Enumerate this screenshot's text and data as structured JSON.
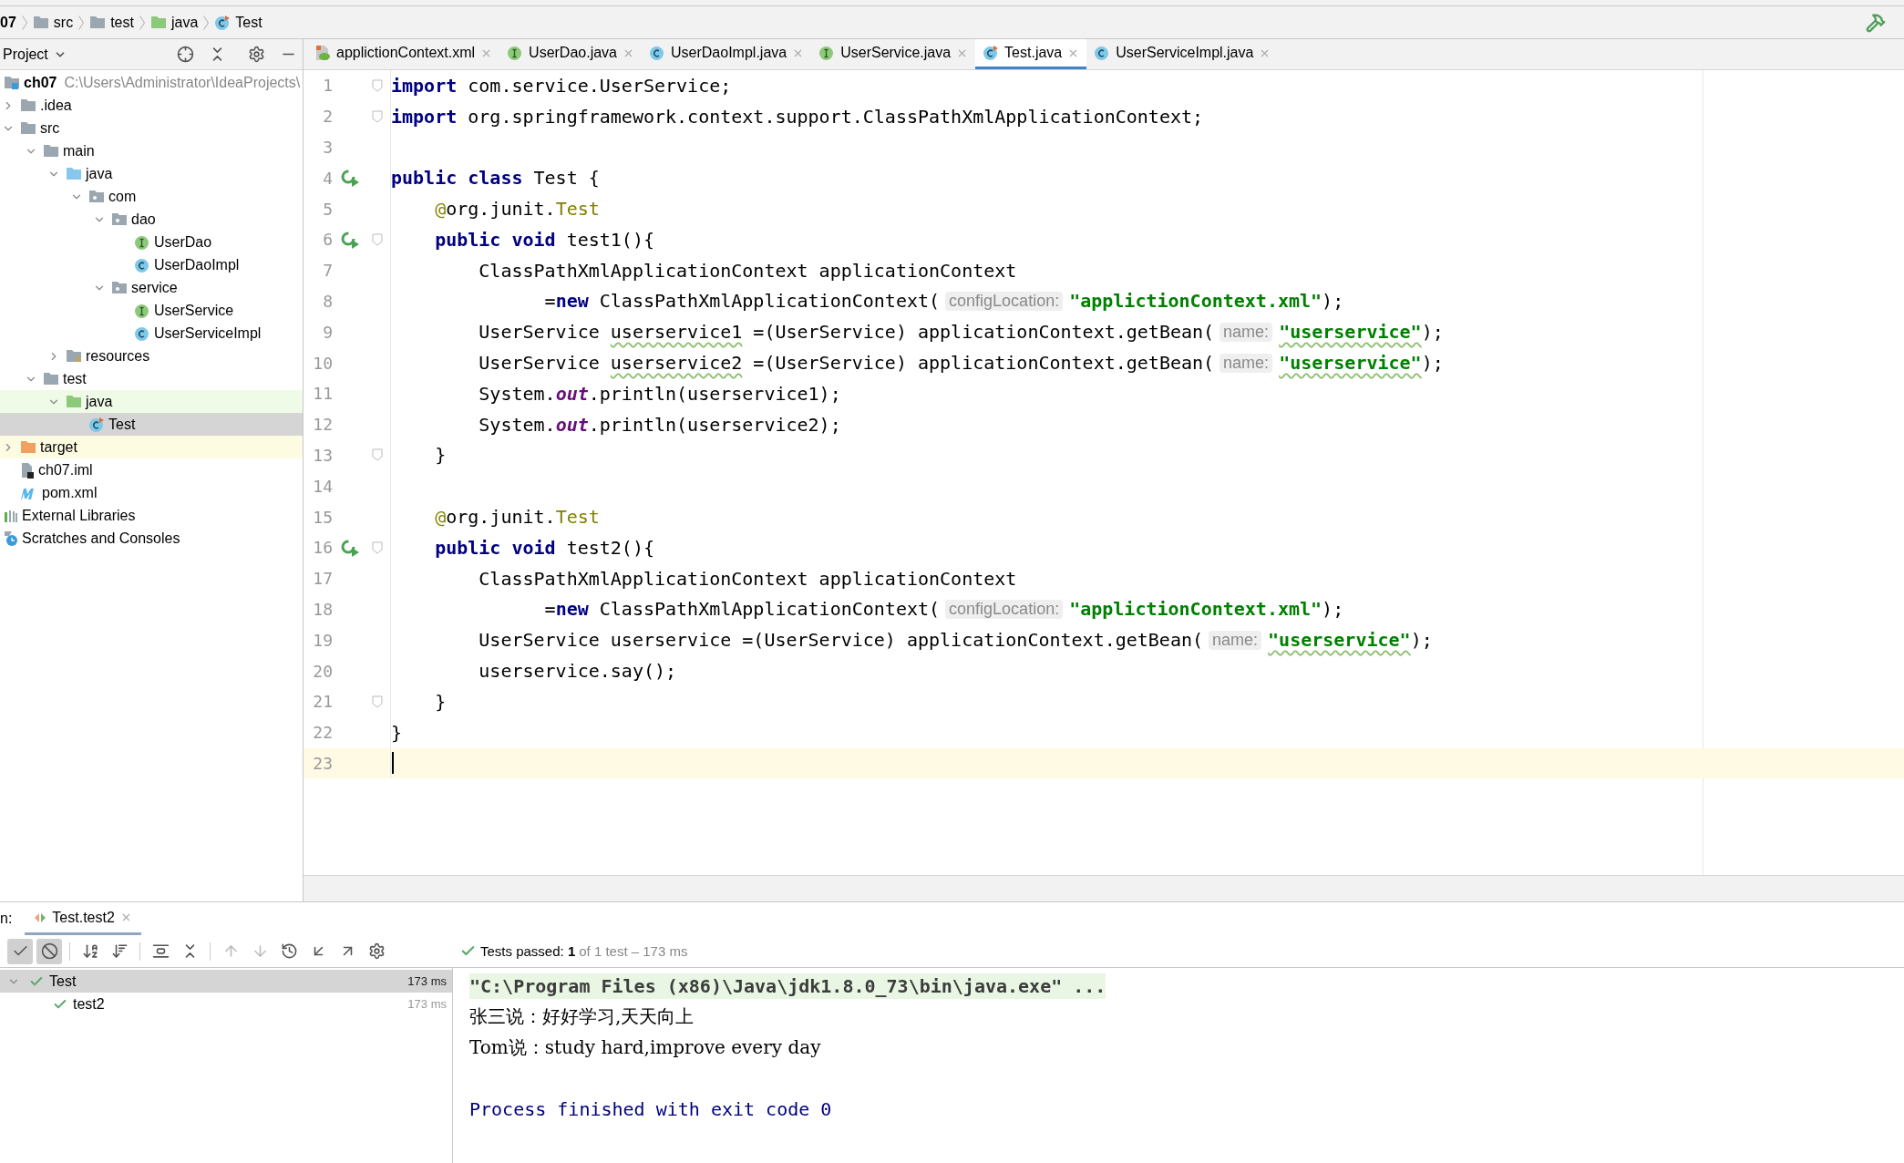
{
  "breadcrumb": [
    {
      "label": "07"
    },
    {
      "label": "src",
      "kind": "folder"
    },
    {
      "label": "test",
      "kind": "folder"
    },
    {
      "label": "java",
      "kind": "test_folder"
    },
    {
      "label": "Test",
      "kind": "test_class"
    }
  ],
  "project_panel": {
    "title": "Project",
    "tree": [
      {
        "label": "ch07",
        "kind": "module",
        "hint": "C:\\Users\\Administrator\\IdeaProjects\\",
        "selected": false,
        "children": [
          {
            "label": ".idea",
            "kind": "folder",
            "expanded": false,
            "selected": false
          },
          {
            "label": "src",
            "kind": "folder",
            "expanded": true,
            "selected": false,
            "children": [
              {
                "label": "main",
                "kind": "folder",
                "expanded": true,
                "selected": false,
                "children": [
                  {
                    "label": "java",
                    "kind": "source_folder",
                    "expanded": true,
                    "selected": false,
                    "children": [
                      {
                        "label": "com",
                        "kind": "package",
                        "expanded": true,
                        "selected": false,
                        "children": [
                          {
                            "label": "dao",
                            "kind": "package",
                            "expanded": true,
                            "selected": false,
                            "children": [
                              {
                                "label": "UserDao",
                                "kind": "interface",
                                "selected": false
                              },
                              {
                                "label": "UserDaoImpl",
                                "kind": "class",
                                "selected": false
                              }
                            ]
                          },
                          {
                            "label": "service",
                            "kind": "package",
                            "expanded": true,
                            "selected": false,
                            "children": [
                              {
                                "label": "UserService",
                                "kind": "interface",
                                "selected": false
                              },
                              {
                                "label": "UserServiceImpl",
                                "kind": "class",
                                "selected": false
                              }
                            ]
                          }
                        ]
                      }
                    ]
                  },
                  {
                    "label": "resources",
                    "kind": "resources",
                    "expanded": false,
                    "selected": false
                  }
                ]
              },
              {
                "label": "test",
                "kind": "folder",
                "expanded": true,
                "selected": false,
                "children": [
                  {
                    "label": "java",
                    "kind": "test_folder",
                    "expanded": true,
                    "selected": false,
                    "color": "#effbe7",
                    "children": [
                      {
                        "label": "Test",
                        "kind": "test_class",
                        "selected": true
                      }
                    ]
                  }
                ]
              }
            ]
          },
          {
            "label": "target",
            "kind": "excluded",
            "expanded": false,
            "selected": false,
            "color": "#fdfbe2"
          },
          {
            "label": "ch07.iml",
            "kind": "iml",
            "selected": false
          },
          {
            "label": "pom.xml",
            "kind": "maven",
            "selected": false
          }
        ]
      },
      {
        "label": "External Libraries",
        "kind": "libraries",
        "selected": false
      },
      {
        "label": "Scratches and Consoles",
        "kind": "scratches",
        "selected": false
      }
    ]
  },
  "tabs": [
    {
      "label": "applictionContext.xml",
      "kind": "xml",
      "selected": false
    },
    {
      "label": "UserDao.java",
      "kind": "interface",
      "selected": false
    },
    {
      "label": "UserDaoImpl.java",
      "kind": "class",
      "selected": false
    },
    {
      "label": "UserService.java",
      "kind": "interface",
      "selected": false
    },
    {
      "label": "Test.java",
      "kind": "test_class",
      "selected": true
    },
    {
      "label": "UserServiceImpl.java",
      "kind": "class",
      "selected": false
    }
  ],
  "code_lines": [
    {
      "number": "1",
      "run": false,
      "fold": true,
      "current": false,
      "segments": [
        {
          "kind": "keyword",
          "text": "import"
        },
        {
          "kind": "plain",
          "text": " com.service.UserService;"
        }
      ]
    },
    {
      "number": "2",
      "run": false,
      "fold": true,
      "current": false,
      "segments": [
        {
          "kind": "keyword",
          "text": "import"
        },
        {
          "kind": "plain",
          "text": " org.springframework.context.support.ClassPathXmlApplicationContext;"
        }
      ]
    },
    {
      "number": "3",
      "run": false,
      "fold": false,
      "current": false
    },
    {
      "number": "4",
      "run": true,
      "fold": false,
      "current": false,
      "segments": [
        {
          "kind": "keyword",
          "text": "public class"
        },
        {
          "kind": "plain",
          "text": " Test {"
        }
      ]
    },
    {
      "number": "5",
      "run": false,
      "fold": false,
      "current": false,
      "segments": [
        {
          "kind": "annotation",
          "text": "    @"
        },
        {
          "kind": "plain",
          "text": "org.junit."
        },
        {
          "kind": "annotation",
          "text": "Test"
        }
      ]
    },
    {
      "number": "6",
      "run": true,
      "fold": true,
      "current": false,
      "segments": [
        {
          "kind": "keyword",
          "text": "    public void"
        },
        {
          "kind": "plain",
          "text": " test1(){"
        }
      ]
    },
    {
      "number": "7",
      "run": false,
      "fold": false,
      "current": false,
      "segments": [
        {
          "kind": "plain",
          "text": "        ClassPathXmlApplicationContext applicationContext"
        }
      ]
    },
    {
      "number": "8",
      "run": false,
      "fold": false,
      "current": false,
      "segments": [
        {
          "kind": "plain",
          "text": "              ="
        },
        {
          "kind": "keyword",
          "text": "new"
        },
        {
          "kind": "plain",
          "text": " ClassPathXmlApplicationContext("
        },
        {
          "kind": "hint",
          "text": "configLocation:"
        },
        {
          "kind": "string",
          "text": "\"applictionContext.xml\""
        },
        {
          "kind": "plain",
          "text": ");"
        }
      ]
    },
    {
      "number": "9",
      "run": false,
      "fold": false,
      "current": false,
      "segments": [
        {
          "kind": "plain",
          "text": "        UserService "
        },
        {
          "kind": "typo",
          "text": "userservice1"
        },
        {
          "kind": "plain",
          "text": " =(UserService) applicationContext.getBean("
        },
        {
          "kind": "hint",
          "text": "name:"
        },
        {
          "kind": "string_typo",
          "text": "\"userservice\""
        },
        {
          "kind": "plain",
          "text": ");"
        }
      ]
    },
    {
      "number": "10",
      "run": false,
      "fold": false,
      "current": false,
      "segments": [
        {
          "kind": "plain",
          "text": "        UserService "
        },
        {
          "kind": "typo",
          "text": "userservice2"
        },
        {
          "kind": "plain",
          "text": " =(UserService) applicationContext.getBean("
        },
        {
          "kind": "hint",
          "text": "name:"
        },
        {
          "kind": "string_typo",
          "text": "\"userservice\""
        },
        {
          "kind": "plain",
          "text": ");"
        }
      ]
    },
    {
      "number": "11",
      "run": false,
      "fold": false,
      "current": false,
      "segments": [
        {
          "kind": "plain",
          "text": "        System."
        },
        {
          "kind": "static",
          "text": "out"
        },
        {
          "kind": "plain",
          "text": ".println(userservice1);"
        }
      ]
    },
    {
      "number": "12",
      "run": false,
      "fold": false,
      "current": false,
      "segments": [
        {
          "kind": "plain",
          "text": "        System."
        },
        {
          "kind": "static",
          "text": "out"
        },
        {
          "kind": "plain",
          "text": ".println(userservice2);"
        }
      ]
    },
    {
      "number": "13",
      "run": false,
      "fold": true,
      "current": false,
      "segments": [
        {
          "kind": "plain",
          "text": "    }"
        }
      ]
    },
    {
      "number": "14",
      "run": false,
      "fold": false,
      "current": false
    },
    {
      "number": "15",
      "run": false,
      "fold": false,
      "current": false,
      "segments": [
        {
          "kind": "annotation",
          "text": "    @"
        },
        {
          "kind": "plain",
          "text": "org.junit."
        },
        {
          "kind": "annotation",
          "text": "Test"
        }
      ]
    },
    {
      "number": "16",
      "run": true,
      "fold": true,
      "current": false,
      "segments": [
        {
          "kind": "keyword",
          "text": "    public void"
        },
        {
          "kind": "plain",
          "text": " test2(){"
        }
      ]
    },
    {
      "number": "17",
      "run": false,
      "fold": false,
      "current": false,
      "segments": [
        {
          "kind": "plain",
          "text": "        ClassPathXmlApplicationContext applicationContext"
        }
      ]
    },
    {
      "number": "18",
      "run": false,
      "fold": false,
      "current": false,
      "segments": [
        {
          "kind": "plain",
          "text": "              ="
        },
        {
          "kind": "keyword",
          "text": "new"
        },
        {
          "kind": "plain",
          "text": " ClassPathXmlApplicationContext("
        },
        {
          "kind": "hint",
          "text": "configLocation:"
        },
        {
          "kind": "string",
          "text": "\"applictionContext.xml\""
        },
        {
          "kind": "plain",
          "text": ");"
        }
      ]
    },
    {
      "number": "19",
      "run": false,
      "fold": false,
      "current": false,
      "segments": [
        {
          "kind": "plain",
          "text": "        UserService userservice =(UserService) applicationContext.getBean("
        },
        {
          "kind": "hint",
          "text": "name:"
        },
        {
          "kind": "string_typo",
          "text": "\"userservice\""
        },
        {
          "kind": "plain",
          "text": ");"
        }
      ]
    },
    {
      "number": "20",
      "run": false,
      "fold": false,
      "current": false,
      "segments": [
        {
          "kind": "plain",
          "text": "        userservice.say();"
        }
      ]
    },
    {
      "number": "21",
      "run": false,
      "fold": true,
      "current": false,
      "segments": [
        {
          "kind": "plain",
          "text": "    }"
        }
      ]
    },
    {
      "number": "22",
      "run": false,
      "fold": false,
      "current": false,
      "segments": [
        {
          "kind": "plain",
          "text": "}"
        }
      ]
    },
    {
      "number": "23",
      "run": false,
      "fold": false,
      "current": true
    }
  ],
  "run_panel": {
    "label": "n:",
    "tab": {
      "label": "Test.test2",
      "selected": true
    },
    "toolbar": [
      {
        "kind": "check",
        "on": true,
        "disabled": false
      },
      {
        "kind": "stop",
        "on": true,
        "disabled": false
      },
      {
        "kind": "sort_alpha",
        "on": false,
        "disabled": false
      },
      {
        "kind": "sort_duration",
        "on": false,
        "disabled": false
      },
      {
        "kind": "expand",
        "on": false,
        "disabled": false
      },
      {
        "kind": "collapse",
        "on": false,
        "disabled": false
      },
      {
        "kind": "up",
        "on": false,
        "disabled": true
      },
      {
        "kind": "down",
        "on": false,
        "disabled": true
      },
      {
        "kind": "history",
        "on": false,
        "disabled": false
      },
      {
        "kind": "import",
        "on": false,
        "disabled": false
      },
      {
        "kind": "export",
        "on": false,
        "disabled": false
      },
      {
        "kind": "settings",
        "on": false,
        "disabled": false
      }
    ],
    "status": "Tests passed: **1**",
    "status_detail": "of 1 test – 173 ms",
    "tests": [
      {
        "label": "Test",
        "time": "173 ms",
        "selected": true,
        "expanded": true,
        "children": [
          {
            "label": "test2",
            "time": "173 ms",
            "selected": false
          }
        ]
      }
    ],
    "console": [
      {
        "kind": "command",
        "text": "\"C:\\Program Files (x86)\\Java\\jdk1.8.0_73\\bin\\java.exe\" ..."
      },
      {
        "kind": "output",
        "text": "张三说：好好学习,天天向上"
      },
      {
        "kind": "output",
        "text": "Tom说：study hard,improve every day"
      },
      {
        "kind": "exit",
        "text": "Process finished with exit code 0"
      }
    ]
  }
}
